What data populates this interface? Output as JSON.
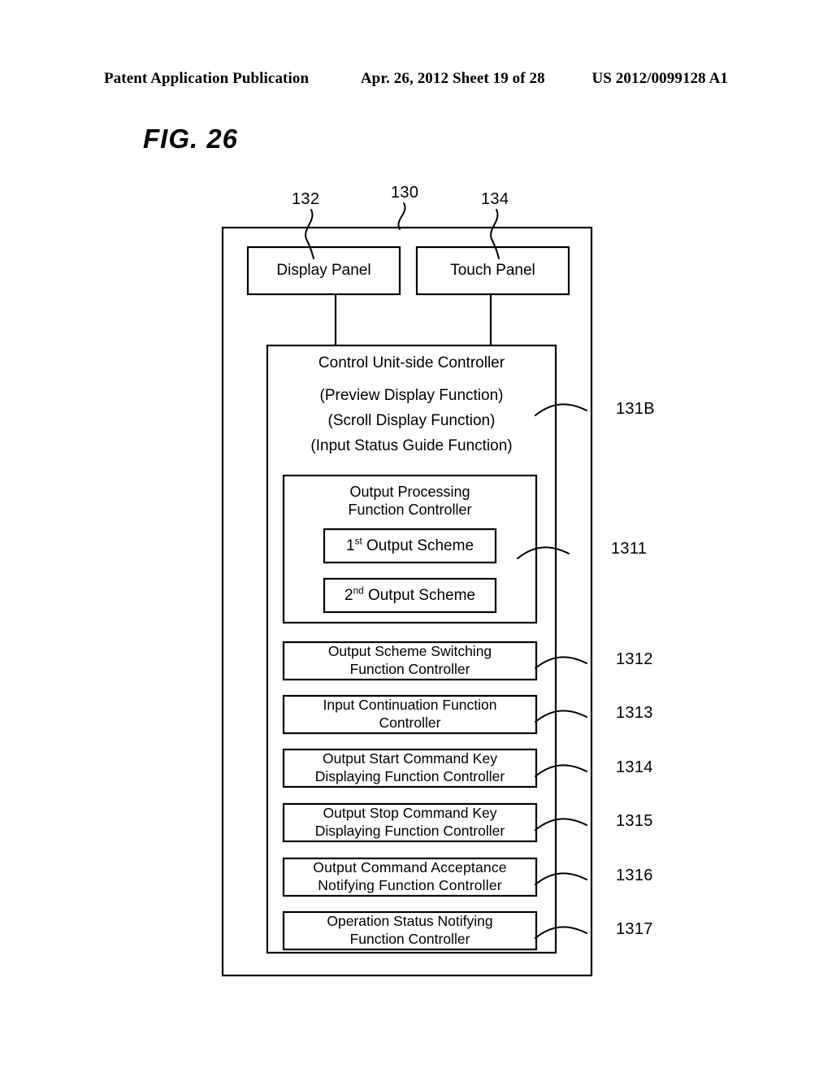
{
  "header": {
    "left": "Patent Application Publication",
    "middle": "Apr. 26, 2012  Sheet 19 of 28",
    "right": "US 2012/0099128 A1"
  },
  "figure": {
    "title": "FIG. 26"
  },
  "callouts": {
    "top_left": "132",
    "top_center": "130",
    "top_right": "134",
    "controller": "131B",
    "output_processing": "1311",
    "scheme_switching": "1312",
    "input_continuation": "1313",
    "output_start_key": "1314",
    "output_stop_key": "1315",
    "command_acceptance": "1316",
    "operation_status": "1317"
  },
  "blocks": {
    "display_panel": "Display Panel",
    "touch_panel": "Touch Panel",
    "controller_title": "Control Unit-side Controller",
    "controller_functions": [
      "(Preview Display Function)",
      "(Scroll Display Function)",
      "(Input Status Guide Function)"
    ],
    "output_processing_title": "Output Processing\nFunction Controller",
    "scheme_1_prefix": "1",
    "scheme_1_sup": "st",
    "scheme_1_suffix": " Output Scheme",
    "scheme_2_prefix": "2",
    "scheme_2_sup": "nd",
    "scheme_2_suffix": " Output Scheme",
    "function_controllers": [
      "Output Scheme Switching\nFunction Controller",
      "Input Continuation Function\nController",
      "Output Start Command Key\nDisplaying Function Controller",
      "Output Stop Command Key\nDisplaying Function Controller",
      "Output  Command  Acceptance\nNotifying Function Controller",
      "Operation Status Notifying\nFunction Controller"
    ]
  }
}
